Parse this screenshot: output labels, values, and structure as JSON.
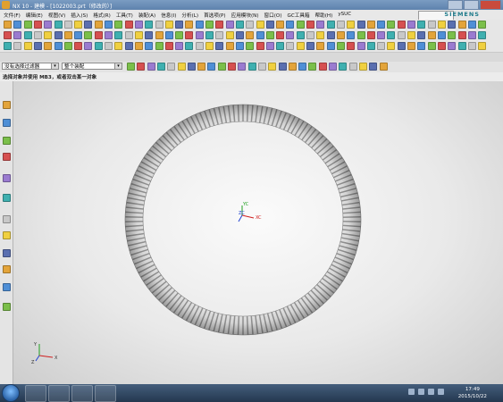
{
  "window": {
    "title": "NX 10 - 建模 - [1022003.prt（修改的）]"
  },
  "brand": "SIEMENS",
  "menu": {
    "items": [
      "文件(F)",
      "编辑(E)",
      "视图(V)",
      "插入(S)",
      "格式(R)",
      "工具(T)",
      "装配(A)",
      "信息(I)",
      "分析(L)",
      "首选项(P)",
      "应用模块(N)",
      "窗口(O)",
      "GC工具箱",
      "帮助(H)",
      "ySUC"
    ]
  },
  "filter_bar": {
    "type_filter": "没有选择过滤器",
    "scope": "整个装配"
  },
  "cue_line": "选择对象并使用 MB3，或者双击某一对象",
  "viewport": {
    "wcs_labels": {
      "yc": "YC",
      "zc": "ZC",
      "xc": "XC"
    },
    "triad_labels": {
      "y": "Y",
      "z": "Z",
      "x": "X"
    }
  },
  "taskbar": {
    "time": "17:49",
    "date": "2015/10/22"
  },
  "colors": {
    "title_bar": "#5e82ad",
    "accent_orange": "#e0a030",
    "siemens_teal": "#1d7a8a",
    "x_axis": "#d02020",
    "y_axis": "#20a020",
    "z_axis": "#2040d0"
  }
}
